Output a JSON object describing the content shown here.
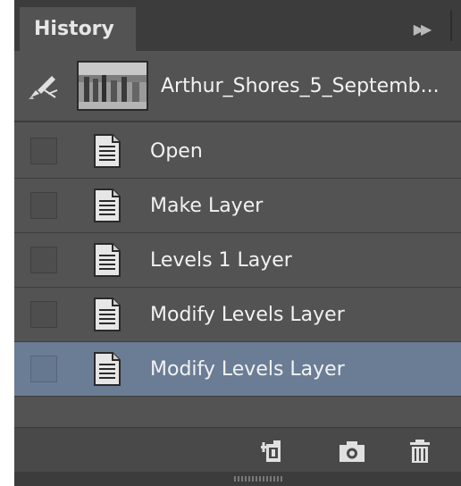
{
  "panel": {
    "tab_title": "History",
    "menu_icon": "double-chevron-right-icon"
  },
  "snapshot": {
    "label": "Arthur_Shores_5_Septemb...",
    "brush_icon": "history-brush-icon"
  },
  "history_items": [
    {
      "label": "Open",
      "selected": false
    },
    {
      "label": "Make Layer",
      "selected": false
    },
    {
      "label": "Levels 1 Layer",
      "selected": false
    },
    {
      "label": "Modify Levels Layer",
      "selected": false
    },
    {
      "label": "Modify Levels Layer",
      "selected": true
    }
  ],
  "footer": {
    "buttons": [
      "new-document-from-state-icon",
      "camera-icon",
      "trash-icon"
    ]
  },
  "colors": {
    "panel_bg": "#535353",
    "selected_bg": "#6b7d95",
    "text": "#f2f2f2"
  }
}
